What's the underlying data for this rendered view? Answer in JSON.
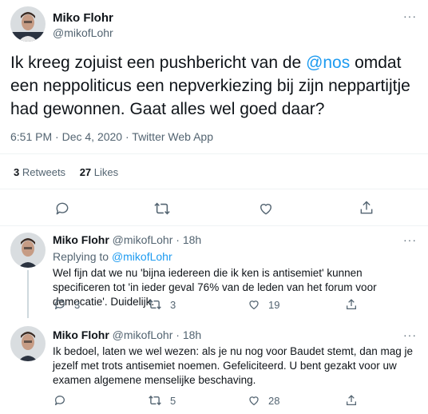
{
  "main_tweet": {
    "author_name": "Miko Flohr",
    "handle": "@mikofLohr",
    "text_part1": "Ik kreeg zojuist een pushbericht van de ",
    "mention": "@nos",
    "text_part2": " omdat een neppoliticus een nepverkiezing bij zijn neppartijtje had gewonnen. Gaat alles wel goed daar?",
    "time": "6:51 PM",
    "sep": "·",
    "date": "Dec 4, 2020",
    "source": "Twitter Web App",
    "retweets_count": "3",
    "retweets_label": "Retweets",
    "likes_count": "27",
    "likes_label": "Likes"
  },
  "replies": [
    {
      "author_name": "Miko Flohr",
      "handle": "@mikofLohr",
      "sep": "·",
      "age": "18h",
      "replying_label": "Replying to",
      "replying_to": "@mikofLohr",
      "text": "Wel fijn dat we nu 'bijna iedereen die ik ken is antisemiet' kunnen specificeren tot 'in ieder geval 76% van de leden van het forum voor democatie'. Duidelijk.",
      "reply_count": "3",
      "retweet_count": "3",
      "like_count": "19"
    },
    {
      "author_name": "Miko Flohr",
      "handle": "@mikofLohr",
      "sep": "·",
      "age": "18h",
      "text": "Ik bedoel, laten we wel wezen: als je nu nog voor Baudet stemt, dan mag je jezelf met trots antisemiet noemen. Gefeliciteerd. U bent gezakt voor uw examen algemene menselijke beschaving.",
      "reply_count": "",
      "retweet_count": "5",
      "like_count": "28"
    }
  ],
  "colors": {
    "accent": "#1d9bf0",
    "muted": "#536471",
    "text": "#0f1419",
    "divider": "#eff3f4"
  }
}
